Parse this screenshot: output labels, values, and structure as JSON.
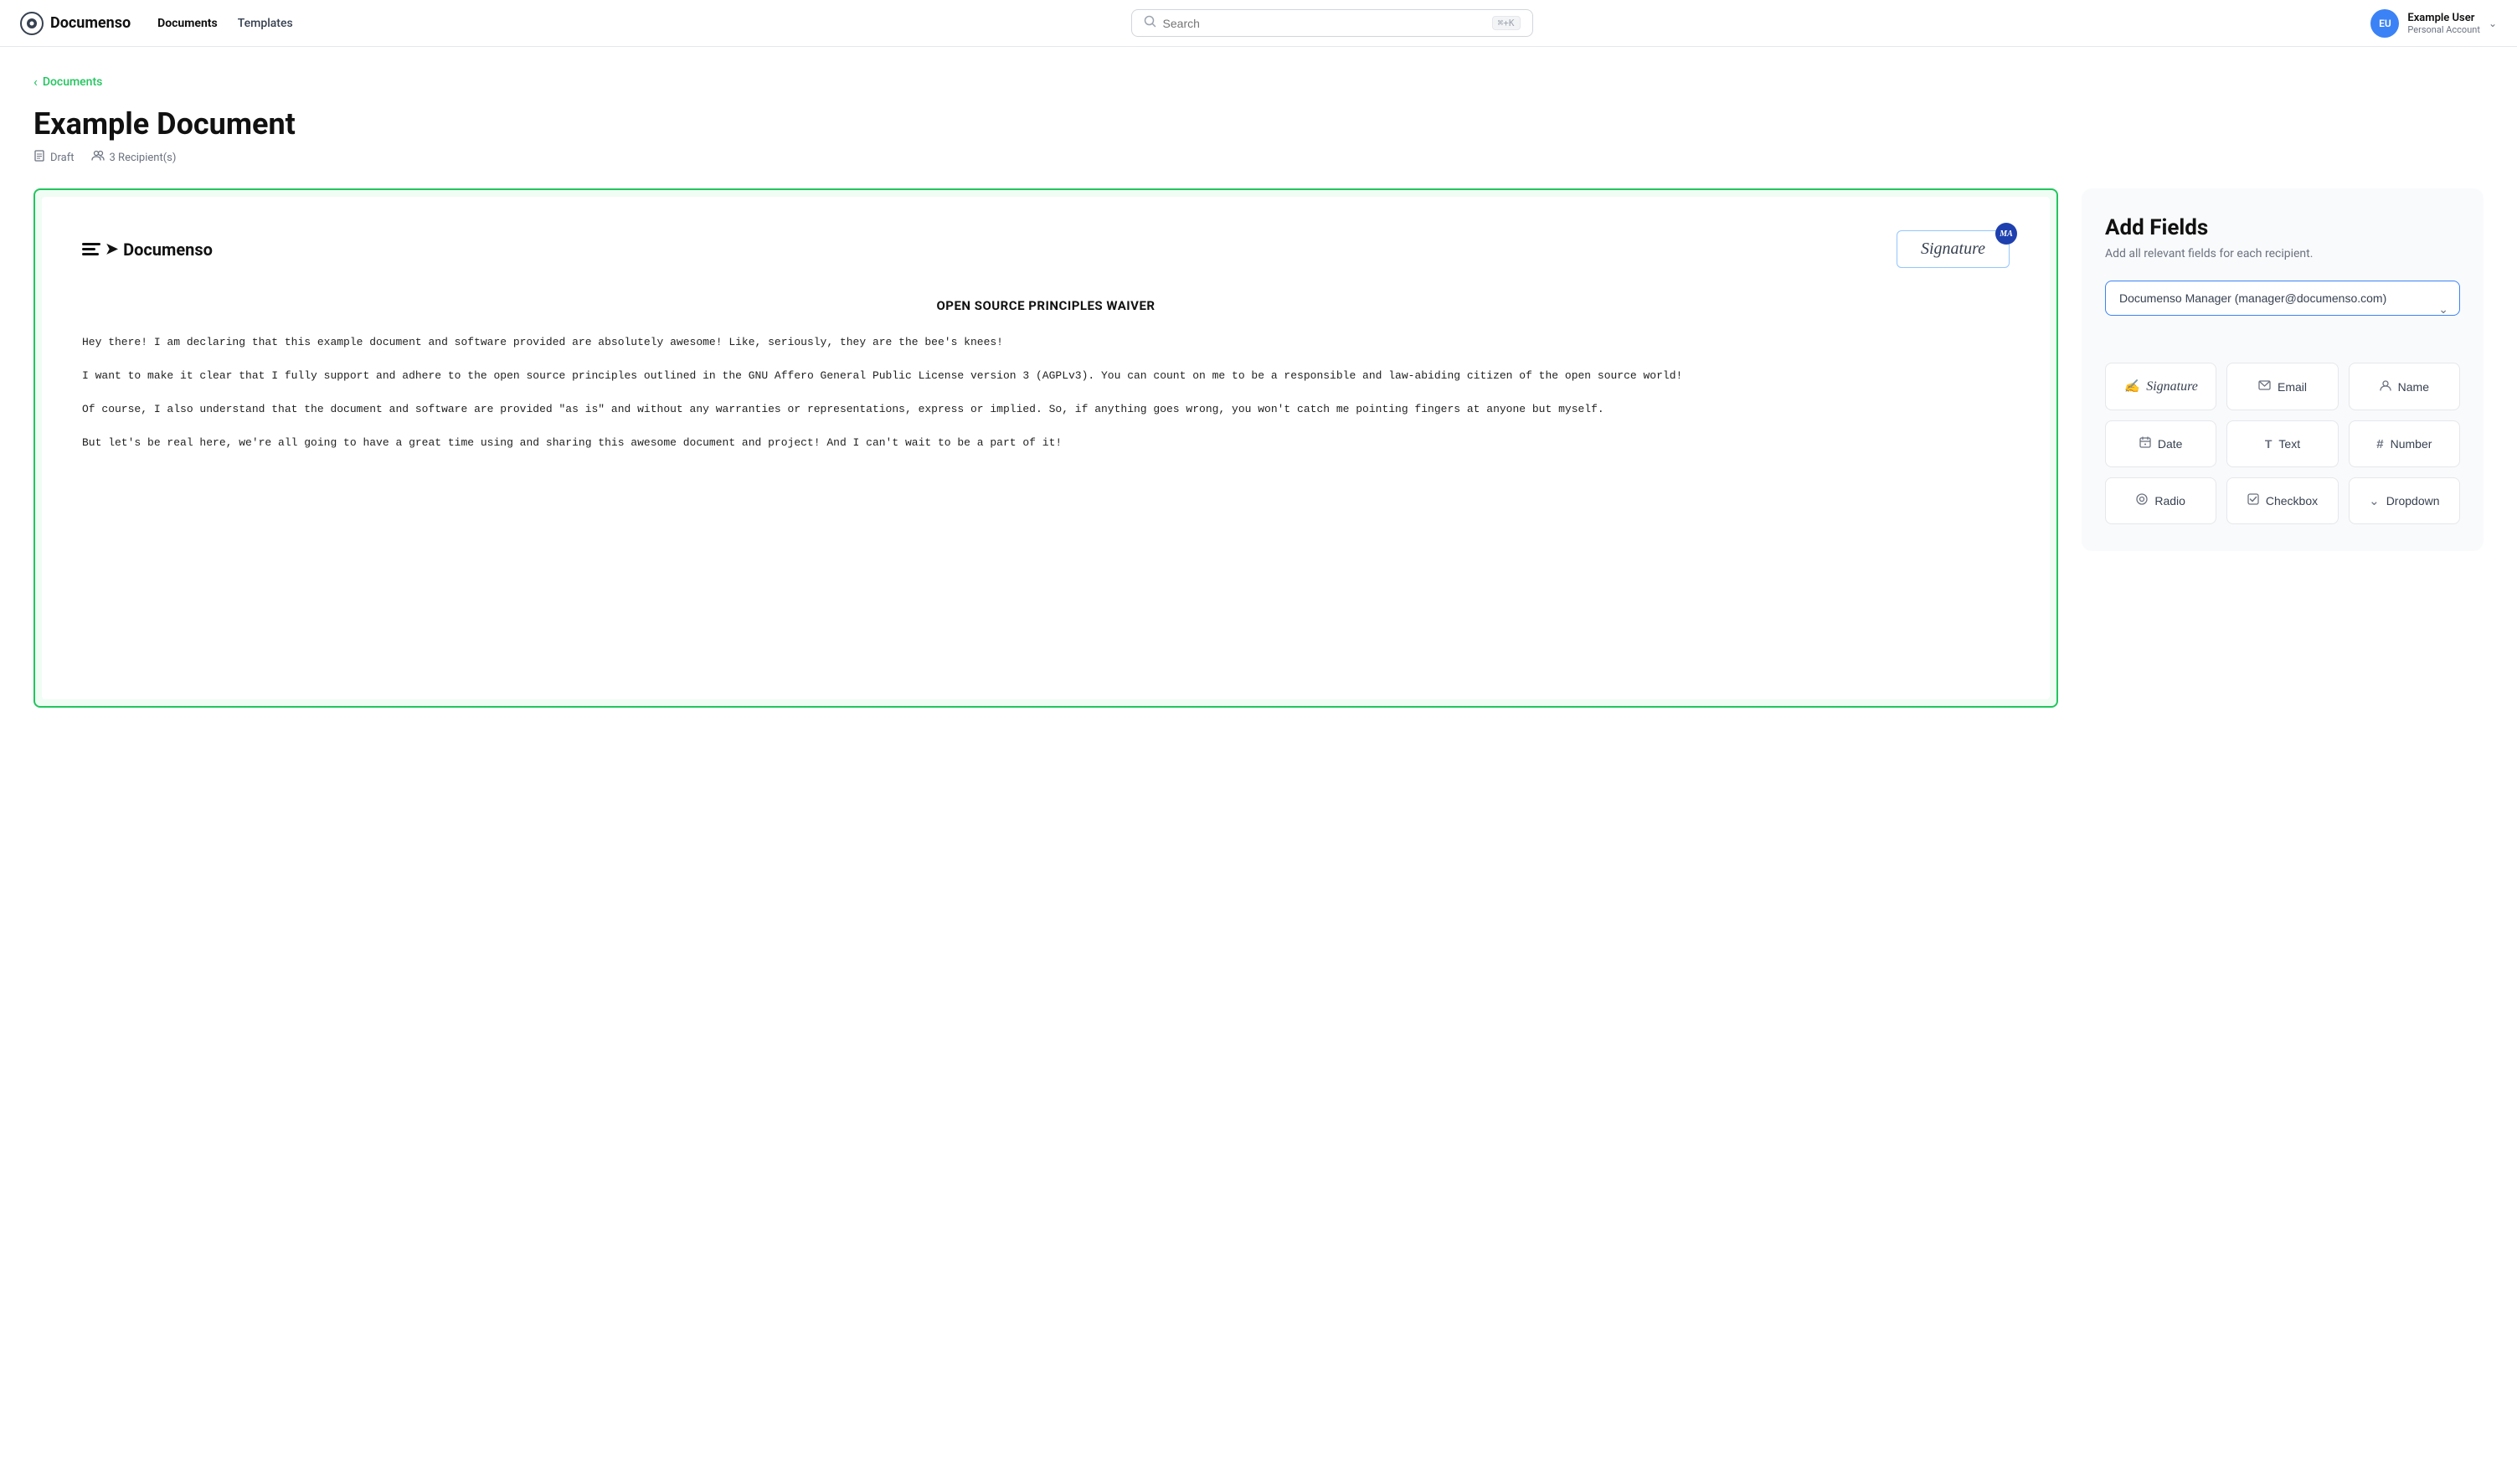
{
  "navbar": {
    "logo_text": "Documenso",
    "links": [
      {
        "label": "Documents",
        "active": true
      },
      {
        "label": "Templates",
        "active": false
      }
    ],
    "search_placeholder": "Search",
    "search_shortcut": "⌘+K",
    "user": {
      "initials": "EU",
      "name": "Example User",
      "account": "Personal Account"
    }
  },
  "breadcrumb": {
    "label": "Documents"
  },
  "page": {
    "title": "Example Document",
    "status": "Draft",
    "recipients": "3 Recipient(s)"
  },
  "document": {
    "logo_text": "Documenso",
    "signature_label": "Signature",
    "signature_badge": "MA",
    "title": "OPEN SOURCE PRINCIPLES WAIVER",
    "paragraphs": [
      "Hey there! I am declaring that this example document and software provided are absolutely awesome! Like, seriously, they are the bee's knees!",
      "I want to make it clear that I fully support and adhere to the open source principles outlined in the GNU Affero General Public License version 3 (AGPLv3). You can count on me to be a responsible and law-abiding citizen of the open source world!",
      "Of course, I also understand that the document and software are provided \"as is\" and without any warranties or representations, express or implied. So, if anything goes wrong, you won't catch me pointing fingers at anyone but myself.",
      "But let's be real here, we're all going to have a great time using and sharing this awesome document and project! And I can't wait to be a part of it!"
    ]
  },
  "add_fields": {
    "title": "Add Fields",
    "subtitle": "Add all relevant fields for each recipient.",
    "recipient_select": {
      "value": "Documenso Manager (manager@documenso.com)",
      "options": [
        "Documenso Manager (manager@documenso.com)"
      ]
    },
    "fields": [
      {
        "id": "signature",
        "label": "Signature",
        "icon": "✍",
        "italic": true
      },
      {
        "id": "email",
        "label": "Email",
        "icon": "✉"
      },
      {
        "id": "name",
        "label": "Name",
        "icon": "👤"
      },
      {
        "id": "date",
        "label": "Date",
        "icon": "📅"
      },
      {
        "id": "text",
        "label": "Text",
        "icon": "T"
      },
      {
        "id": "number",
        "label": "Number",
        "icon": "#"
      },
      {
        "id": "radio",
        "label": "Radio",
        "icon": "◎"
      },
      {
        "id": "checkbox",
        "label": "Checkbox",
        "icon": "☑"
      },
      {
        "id": "dropdown",
        "label": "Dropdown",
        "icon": "⌄"
      }
    ]
  }
}
